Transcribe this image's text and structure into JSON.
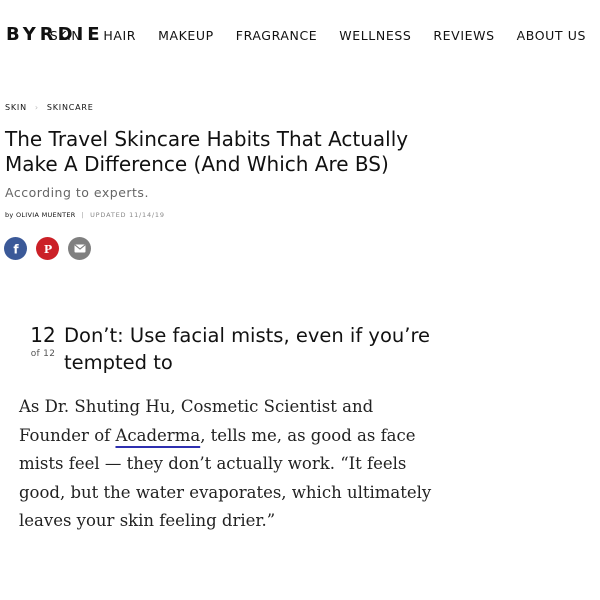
{
  "nav": {
    "logo": "BYRDIE",
    "items": [
      "SKIN",
      "HAIR",
      "MAKEUP",
      "FRAGRANCE",
      "WELLNESS",
      "REVIEWS",
      "ABOUT US"
    ]
  },
  "breadcrumb": {
    "items": [
      "SKIN",
      "SKINCARE"
    ]
  },
  "article": {
    "title": "The Travel Skincare Habits That Actually Make A Difference (And Which Are BS)",
    "subtitle": "According to experts.",
    "byline_prefix": "by",
    "author": "OLIVIA MUENTER",
    "updated": "UPDATED 11/14/19"
  },
  "share": {
    "icons": [
      "facebook-icon",
      "pinterest-icon",
      "email-icon"
    ],
    "colors": {
      "facebook": "#3b5998",
      "pinterest": "#cb2027",
      "email": "#7f7f7f"
    }
  },
  "slide": {
    "number": "12",
    "of": "of 12",
    "title": "Don’t: Use facial mists, even if you’re tempted to",
    "body_before": "As Dr. Shuting Hu, Cosmetic Scientist and Founder of ",
    "body_link": "Acaderma",
    "body_after": ", tells me, as good as face mists feel — they don’t actually work. “It feels good, but the water evaporates, which ultimately leaves your skin feeling drier.”"
  },
  "colors": {
    "link_underline": "#2e2fb0"
  }
}
